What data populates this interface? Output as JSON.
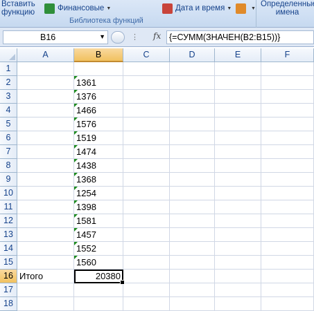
{
  "ribbon": {
    "insert_function": "Вставить функцию",
    "financial": "Финансовые",
    "datetime": "Дата и время",
    "group_label": "Библиотека функций",
    "defined_names": "Определенные имена"
  },
  "formula_bar": {
    "name_box": "B16",
    "fx": "fx",
    "formula": "{=СУММ(ЗНАЧЕН(B2:B15))}"
  },
  "columns": [
    "A",
    "B",
    "C",
    "D",
    "E",
    "F"
  ],
  "rows": [
    {
      "num": "1",
      "a": "",
      "b": ""
    },
    {
      "num": "2",
      "a": "",
      "b": "1361"
    },
    {
      "num": "3",
      "a": "",
      "b": "1376"
    },
    {
      "num": "4",
      "a": "",
      "b": "1466"
    },
    {
      "num": "5",
      "a": "",
      "b": "1576"
    },
    {
      "num": "6",
      "a": "",
      "b": "1519"
    },
    {
      "num": "7",
      "a": "",
      "b": "1474"
    },
    {
      "num": "8",
      "a": "",
      "b": "1438"
    },
    {
      "num": "9",
      "a": "",
      "b": "1368"
    },
    {
      "num": "10",
      "a": "",
      "b": "1254"
    },
    {
      "num": "11",
      "a": "",
      "b": "1398"
    },
    {
      "num": "12",
      "a": "",
      "b": "1581"
    },
    {
      "num": "13",
      "a": "",
      "b": "1457"
    },
    {
      "num": "14",
      "a": "",
      "b": "1552"
    },
    {
      "num": "15",
      "a": "",
      "b": "1560"
    },
    {
      "num": "16",
      "a": "Итого",
      "b": "20380"
    },
    {
      "num": "17",
      "a": "",
      "b": ""
    },
    {
      "num": "18",
      "a": "",
      "b": ""
    }
  ]
}
